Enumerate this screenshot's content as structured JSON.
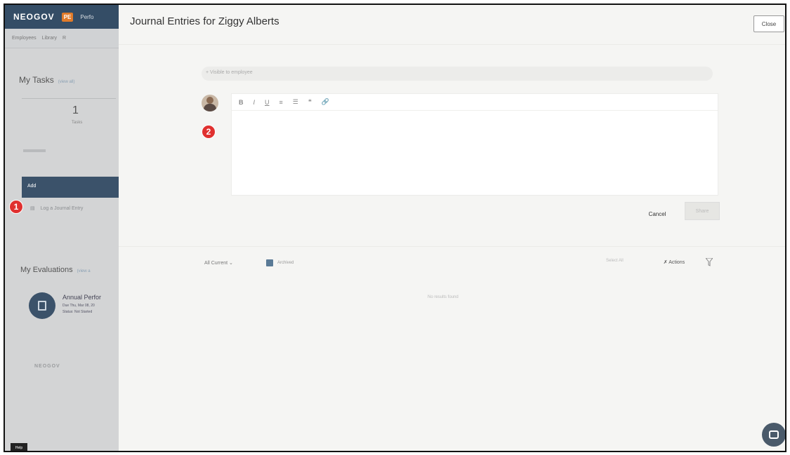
{
  "background_app": {
    "brand": "NEOGOV",
    "product_badge": "PE",
    "product_name": "Perfo",
    "nav": [
      "Employees",
      "Library",
      "R"
    ],
    "tasks_heading": "My Tasks",
    "tasks_view_all": "(view all)",
    "tasks_count": "1",
    "tasks_count_label": "Tasks",
    "add_label": "Add",
    "journal_link": "Log a Journal Entry",
    "evaluations_heading": "My Evaluations",
    "evaluations_view_all": "(view a",
    "evaluation": {
      "title": "Annual Perfor",
      "due": "Due Thu, Mar 08, 20",
      "status": "Status: Not Started"
    },
    "footer_brand": "NEOGOV",
    "help_chip": "Help"
  },
  "badges": {
    "step1": "1",
    "step2": "2"
  },
  "panel": {
    "title": "Journal Entries for Ziggy Alberts",
    "close_label": "Close",
    "visibility_text": "+ Visible to employee",
    "toolbar": {
      "bold": "B",
      "italic": "I",
      "underline": "U",
      "ordered_list": "≡",
      "bullet_list": "☰",
      "quote": "❝",
      "link": "🔗"
    },
    "editor_placeholder": "",
    "cancel_label": "Cancel",
    "share_label": "Share",
    "filter_label": "All Current ⌄",
    "filter_checkbox_label": "Archived",
    "select_all": "Select All",
    "actions_label": "✗ Actions",
    "empty_text": "No results found"
  },
  "colors": {
    "brand_navy": "#344d66",
    "badge_red": "#e0302f",
    "panel_bg": "#f5f5f3"
  },
  "icons": {
    "avatar": "user-avatar-photo",
    "funnel": "funnel-icon",
    "chat": "chat-bubble-icon",
    "evaluation": "document-icon"
  }
}
